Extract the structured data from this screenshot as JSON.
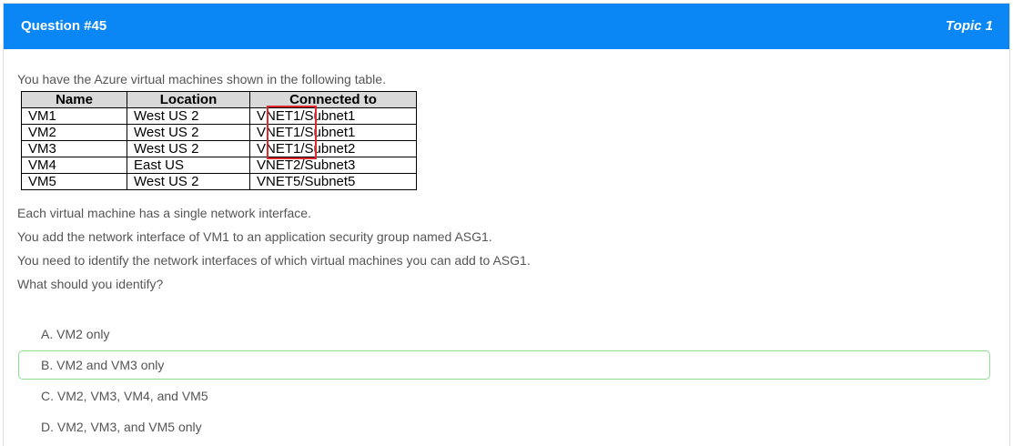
{
  "header": {
    "question_label": "Question #45",
    "topic_label": "Topic 1"
  },
  "question": {
    "intro": "You have the Azure virtual machines shown in the following table.",
    "table": {
      "headers": [
        "Name",
        "Location",
        "Connected to"
      ],
      "rows": [
        [
          "VM1",
          "West US 2",
          "VNET1/Subnet1"
        ],
        [
          "VM2",
          "West US 2",
          "VNET1/Subnet1"
        ],
        [
          "VM3",
          "West US 2",
          "VNET1/Subnet2"
        ],
        [
          "VM4",
          "East US",
          "VNET2/Subnet3"
        ],
        [
          "VM5",
          "West US 2",
          "VNET5/Subnet5"
        ]
      ],
      "highlight_color": "#e0282d"
    },
    "lines": [
      "Each virtual machine has a single network interface.",
      "You add the network interface of VM1 to an application security group named ASG1.",
      "You need to identify the network interfaces of which virtual machines you can add to ASG1.",
      "What should you identify?"
    ]
  },
  "options": [
    {
      "label": "A. VM2 only",
      "selected": false
    },
    {
      "label": "B. VM2 and VM3 only",
      "selected": true
    },
    {
      "label": "C. VM2, VM3, VM4, and VM5",
      "selected": false
    },
    {
      "label": "D. VM2, VM3, and VM5 only",
      "selected": false
    }
  ],
  "colors": {
    "header_bg": "#0a86f5",
    "correct_border": "#8fdc8f"
  }
}
